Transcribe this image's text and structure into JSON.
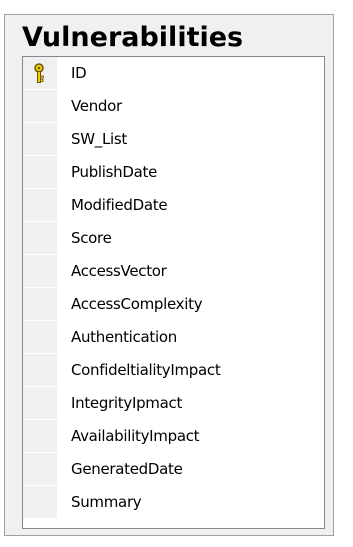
{
  "table": {
    "title": "Vulnerabilities",
    "primary_key_icon": "key-icon",
    "columns": [
      "ID",
      "Vendor",
      "SW_List",
      "PublishDate",
      "ModifiedDate",
      "Score",
      "AccessVector",
      "AccessComplexity",
      "Authentication",
      "ConfideltialityImpact",
      "IntegrityIpmact",
      "AvailabilityImpact",
      "GeneratedDate",
      "Summary"
    ]
  },
  "colors": {
    "panel_bg": "#f0f0f0",
    "grid_bg": "#ffffff",
    "key_icon": "#e8c100"
  }
}
